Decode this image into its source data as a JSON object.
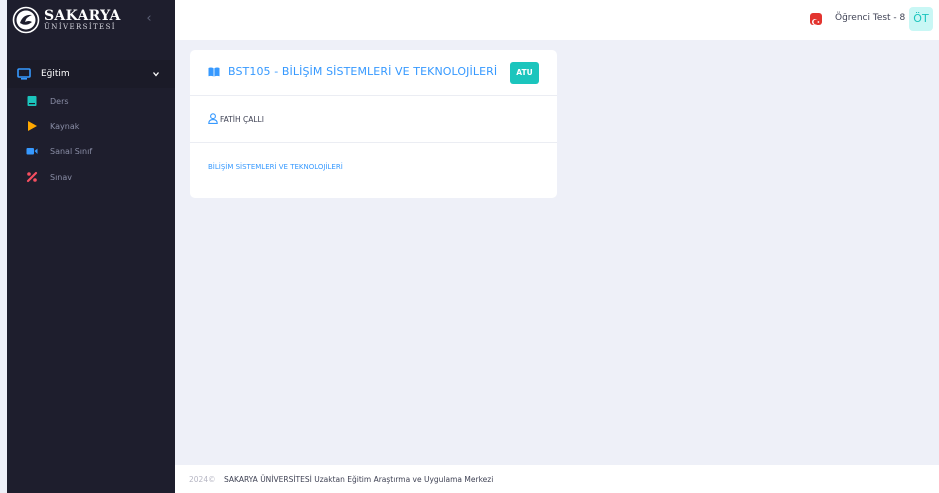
{
  "brand": {
    "title": "SAKARYA",
    "subtitle": "ÜNİVERSİTESİ"
  },
  "sidebar": {
    "section": {
      "label": "Eğitim",
      "icon": "monitor-icon"
    },
    "items": [
      {
        "label": "Ders",
        "icon": "book-icon",
        "color": "#1bc5bd"
      },
      {
        "label": "Kaynak",
        "icon": "play-icon",
        "color": "#ffa800"
      },
      {
        "label": "Sanal Sınıf",
        "icon": "video-icon",
        "color": "#3699ff"
      },
      {
        "label": "Sınav",
        "icon": "exam-icon",
        "color": "#f64e60"
      }
    ]
  },
  "topbar": {
    "user_name": "Öğrenci Test - 8",
    "avatar_initials": "ÖT",
    "flag": "turkey-flag-icon"
  },
  "course": {
    "title": "BST105 - BİLİŞİM SİSTEMLERİ VE TEKNOLOJİLERİ",
    "badge": "ATU",
    "instructor": "FATİH ÇALLI",
    "link": "BİLİŞİM SİSTEMLERİ VE TEKNOLOJİLERİ"
  },
  "footer": {
    "year": "2024©",
    "text": "SAKARYA ÜNİVERSİTESİ Uzaktan Eğitim Araştırma ve Uygulama Merkezi"
  },
  "colors": {
    "sidebar_bg": "#1e1e2d",
    "primary": "#3699ff",
    "success": "#1bc5bd",
    "page_bg": "#eef0f8"
  }
}
